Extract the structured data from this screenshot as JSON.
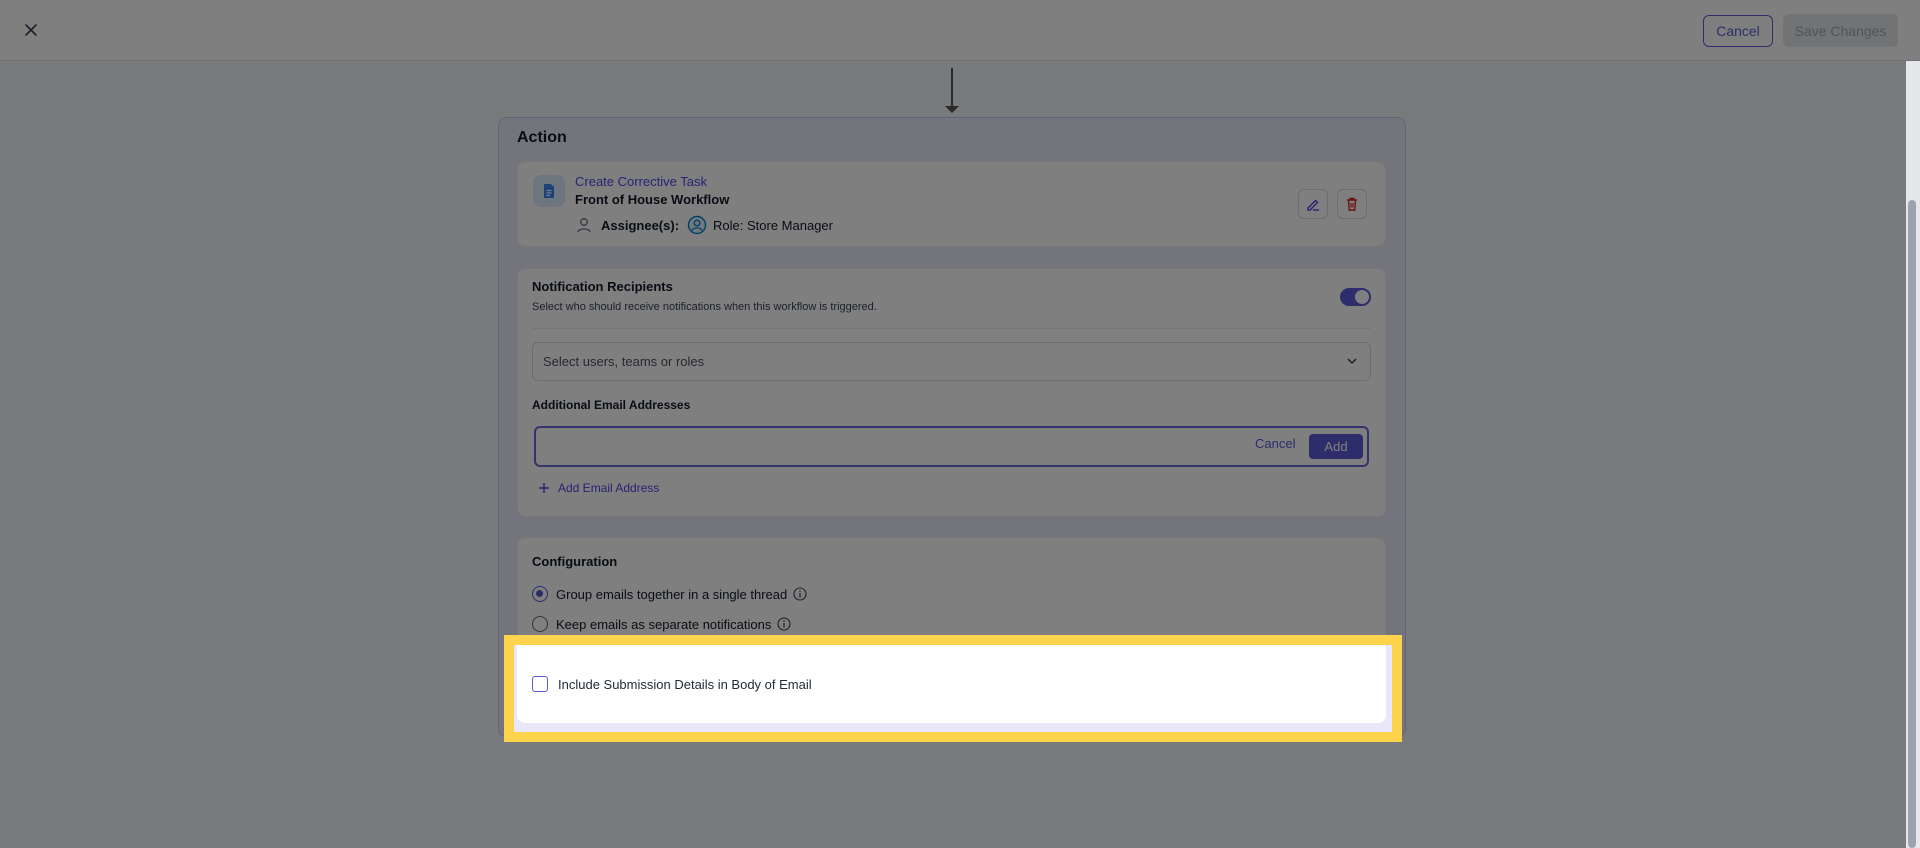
{
  "header": {
    "cancel_label": "Cancel",
    "save_label": "Save Changes"
  },
  "action": {
    "title": "Action",
    "task": {
      "link_label": "Create Corrective Task",
      "workflow": "Front of House Workflow",
      "assignee_label": "Assignee(s):",
      "role": "Role: Store Manager"
    }
  },
  "notifications": {
    "title": "Notification Recipients",
    "subtitle": "Select who should receive notifications when this workflow is triggered.",
    "enabled": true,
    "select_placeholder": "Select users, teams or roles",
    "additional_label": "Additional Email Addresses",
    "email_input_value": "",
    "inline_cancel_label": "Cancel",
    "inline_add_label": "Add",
    "add_email_link": "Add Email Address"
  },
  "configuration": {
    "title": "Configuration",
    "options": [
      {
        "label": "Group emails together in a single thread",
        "selected": true
      },
      {
        "label": "Keep emails as separate notifications",
        "selected": false
      }
    ],
    "include_details_label": "Include Submission Details in Body of Email",
    "include_details_checked": false
  },
  "colors": {
    "accent": "#5b5bd6",
    "highlight": "#fcd34d",
    "danger": "#dc2626"
  },
  "icons": {
    "close": "close-icon",
    "document": "document-icon",
    "user": "user-icon",
    "role": "user-circle-icon",
    "edit": "pencil-icon",
    "delete": "trash-icon",
    "chevron": "chevron-down-icon",
    "plus": "plus-icon",
    "info": "info-icon"
  }
}
